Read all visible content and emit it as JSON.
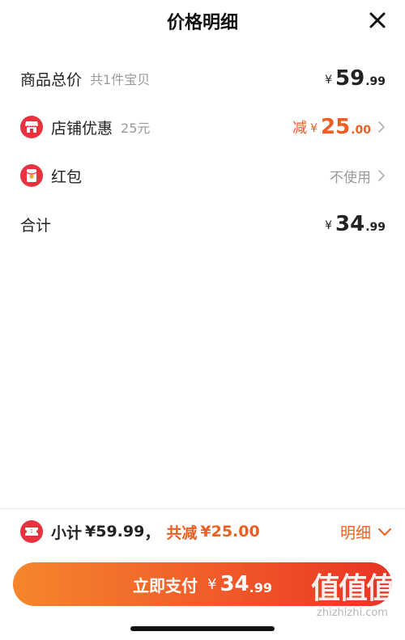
{
  "header": {
    "title": "价格明细"
  },
  "rows": {
    "total": {
      "label": "商品总价",
      "sublabel": "共1件宝贝",
      "yen": "¥",
      "integer": "59",
      "decimal": ".99"
    },
    "shop_discount": {
      "label": "店铺优惠",
      "sublabel": "25元",
      "prefix": "减",
      "yen": "¥",
      "integer": "25",
      "decimal": ".00"
    },
    "red_packet": {
      "label": "红包",
      "value": "不使用"
    },
    "sum": {
      "label": "合计",
      "yen": "¥",
      "integer": "34",
      "decimal": ".99"
    }
  },
  "summary": {
    "subtotal_label": "小计",
    "subtotal_value": "¥59.99",
    "separator": "，",
    "discount_label": "共减",
    "discount_value": "¥25.00",
    "detail_label": "明细"
  },
  "pay_button": {
    "label": "立即支付",
    "yen": "¥",
    "integer": "34",
    "decimal": ".99"
  },
  "watermark": {
    "logo": "值值值",
    "url": "zhizhizhi.com"
  },
  "colors": {
    "accent": "#ec5f22",
    "icon_red": "#e8333f",
    "gray_text": "#9a9a9a"
  },
  "icons": {
    "close": "close-icon",
    "shop": "shop-icon",
    "red_packet": "red-packet-icon",
    "coupon": "coupon-icon",
    "chevron_right": "chevron-right-icon",
    "chevron_down": "chevron-down-icon"
  }
}
